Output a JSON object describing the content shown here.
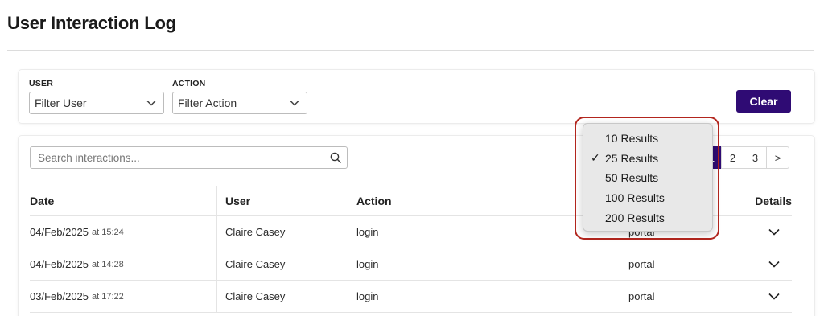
{
  "page": {
    "title": "User Interaction Log"
  },
  "filters": {
    "user": {
      "label": "USER",
      "value": "Filter User"
    },
    "action": {
      "label": "ACTION",
      "value": "Filter Action"
    },
    "clear_label": "Clear"
  },
  "search": {
    "placeholder": "Search interactions..."
  },
  "pagination": {
    "pages": [
      "1",
      "2",
      "3"
    ],
    "current": "1",
    "next_label": ">"
  },
  "table": {
    "columns": {
      "date": "Date",
      "user": "User",
      "action": "Action",
      "application": "",
      "details": "Details"
    },
    "rows": [
      {
        "date": "04/Feb/2025",
        "time": "at 15:24",
        "user": "Claire Casey",
        "action": "login",
        "application": "portal"
      },
      {
        "date": "04/Feb/2025",
        "time": "at 14:28",
        "user": "Claire Casey",
        "action": "login",
        "application": "portal"
      },
      {
        "date": "03/Feb/2025",
        "time": "at 17:22",
        "user": "Claire Casey",
        "action": "login",
        "application": "portal"
      }
    ]
  },
  "results_menu": {
    "selected": "25 Results",
    "check_glyph": "✓",
    "options": [
      "10 Results",
      "25 Results",
      "50 Results",
      "100 Results",
      "200 Results"
    ]
  },
  "colors": {
    "accent": "#2f0b74",
    "highlight_ring": "#b3261e"
  },
  "icons": {
    "select_caret": "chevron-down-icon",
    "search": "search-icon",
    "row_expand": "chevron-down-icon",
    "selected_option": "checkmark-icon"
  }
}
